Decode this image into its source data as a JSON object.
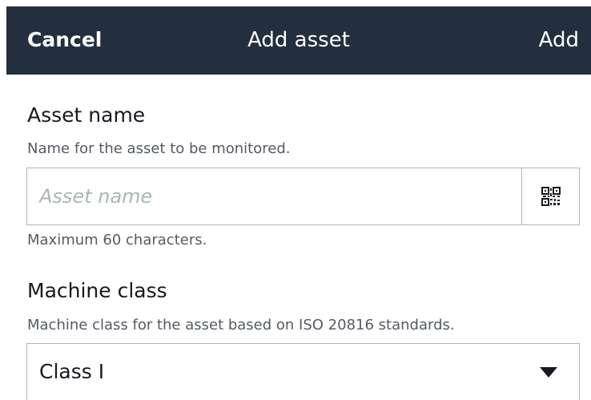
{
  "header": {
    "cancel_label": "Cancel",
    "title": "Add asset",
    "add_label": "Add"
  },
  "asset_name": {
    "label": "Asset name",
    "description": "Name for the asset to be monitored.",
    "placeholder": "Asset name",
    "value": "",
    "hint": "Maximum 60 characters.",
    "scan_icon": "qr-code-icon"
  },
  "machine_class": {
    "label": "Machine class",
    "description": "Machine class for the asset based on ISO 20816 standards.",
    "selected": "Class I",
    "dropdown_icon": "caret-down-icon"
  },
  "colors": {
    "header_bg": "#232f3e",
    "header_text": "#ffffff",
    "border": "#aab7b8",
    "secondary_text": "#545b64"
  }
}
